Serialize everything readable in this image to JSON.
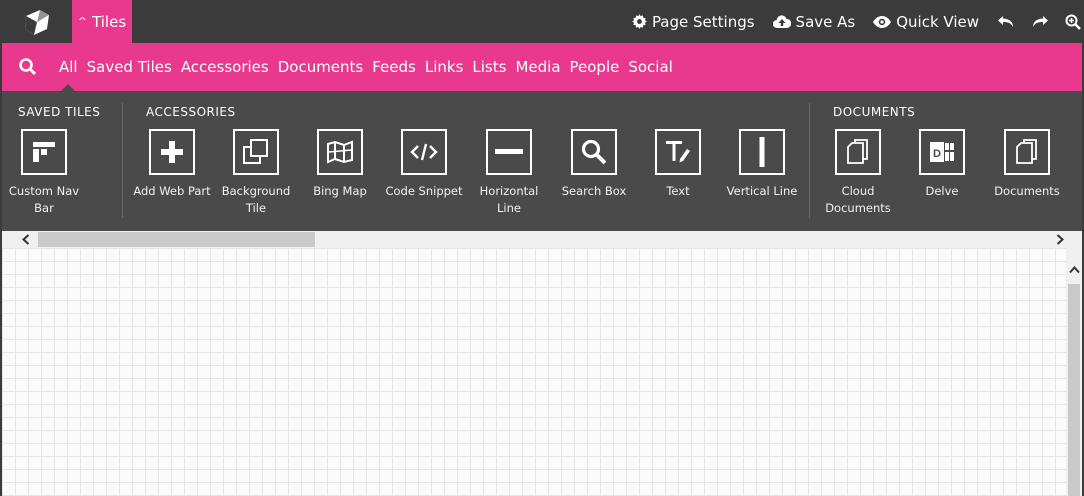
{
  "header": {
    "logo_icon": "cube-logo-icon",
    "tiles_toggle_label": "Tiles",
    "actions": [
      {
        "label": "Page Settings",
        "icon": "gear-icon"
      },
      {
        "label": "Save As",
        "icon": "cloud-upload-icon"
      },
      {
        "label": "Quick View",
        "icon": "eye-icon"
      }
    ],
    "icon_buttons": [
      "undo-icon",
      "redo-icon",
      "zoom-in-icon"
    ]
  },
  "filterbar": {
    "search_icon": "search-icon",
    "filters": [
      "All",
      "Saved Tiles",
      "Accessories",
      "Documents",
      "Feeds",
      "Links",
      "Lists",
      "Media",
      "People",
      "Social"
    ],
    "active": "All"
  },
  "gallery": {
    "groups": [
      {
        "title": "SAVED TILES"
      },
      {
        "title": "ACCESSORIES"
      },
      {
        "title": "DOCUMENTS"
      }
    ],
    "tiles": [
      {
        "label": "Custom Nav Bar",
        "icon": "nav-bar-icon"
      },
      {
        "label": "Add Web Part",
        "icon": "plus-icon"
      },
      {
        "label": "Background Tile",
        "icon": "layers-icon"
      },
      {
        "label": "Bing Map",
        "icon": "map-icon"
      },
      {
        "label": "Code Snippet",
        "icon": "code-icon"
      },
      {
        "label": "Horizontal Line",
        "icon": "horizontal-line-icon"
      },
      {
        "label": "Search Box",
        "icon": "search-icon"
      },
      {
        "label": "Text",
        "icon": "text-icon"
      },
      {
        "label": "Vertical Line",
        "icon": "vertical-line-icon"
      },
      {
        "label": "Cloud Documents",
        "icon": "documents-icon"
      },
      {
        "label": "Delve",
        "icon": "delve-icon"
      },
      {
        "label": "Documents",
        "icon": "documents-icon"
      }
    ]
  },
  "colors": {
    "accent": "#e8398f",
    "dark": "#3b3b3b",
    "panel": "#4a4a4a"
  }
}
